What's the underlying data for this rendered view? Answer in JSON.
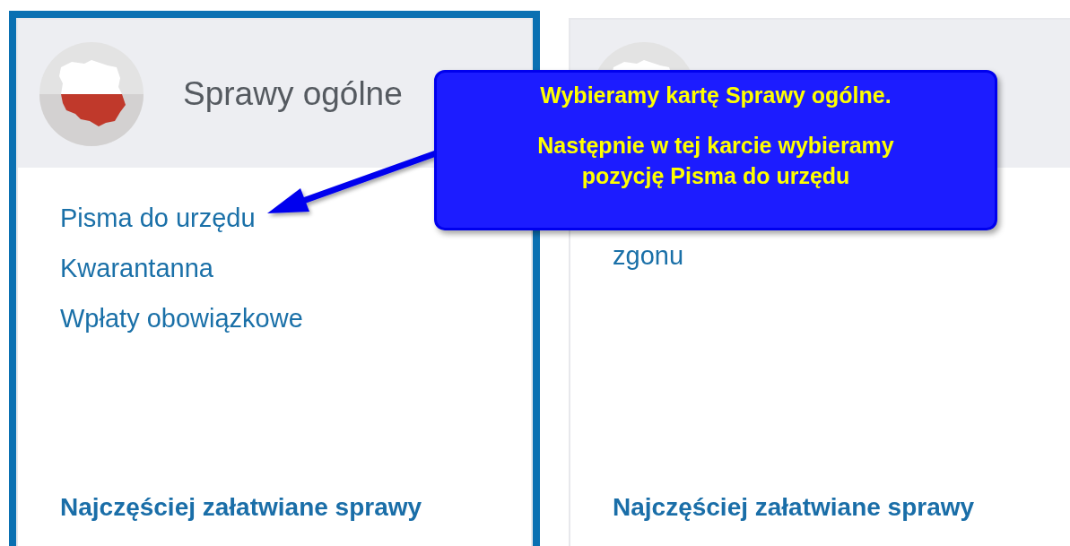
{
  "cards": [
    {
      "title": "Sprawy ogólne",
      "selected": true,
      "links": [
        "Pisma do urzędu",
        "Kwarantanna",
        "Wpłaty obowiązkowe"
      ],
      "footer": "Najczęściej załatwiane sprawy"
    },
    {
      "selected": false,
      "links": [
        "zgonu"
      ],
      "footer": "Najczęściej załatwiane sprawy"
    }
  ],
  "callout": {
    "paragraphs": [
      "Wybieramy kartę Sprawy ogólne.",
      "Następnie w tej karcie wybieramy pozycję Pisma do urzędu"
    ]
  }
}
